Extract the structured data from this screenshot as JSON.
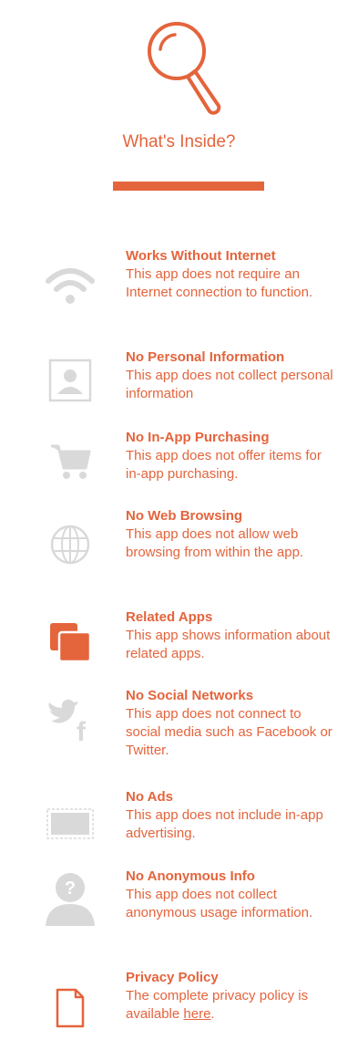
{
  "header": {
    "title": "What's Inside?",
    "icon": "magnifier-icon"
  },
  "colors": {
    "accent": "#e4643c",
    "icon_gray": "#d9d9d9"
  },
  "features": [
    {
      "icon": "wifi-icon",
      "title": "Works Without Internet",
      "desc": "This app does not require an Internet connection to function."
    },
    {
      "icon": "profile-photo-icon",
      "title": "No Personal Information",
      "desc": "This app does not collect personal information"
    },
    {
      "icon": "shopping-cart-icon",
      "title": "No In-App Purchasing",
      "desc": "This app does not offer items for in-app purchasing."
    },
    {
      "icon": "globe-icon",
      "title": "No Web Browsing",
      "desc": "This app does not allow web browsing from within the app."
    },
    {
      "icon": "stacked-squares-icon",
      "title": "Related Apps",
      "desc": "This app shows information about related apps."
    },
    {
      "icon": "twitter-facebook-icon",
      "title": "No Social Networks",
      "desc": "This app does not connect to social media such as Facebook or Twitter."
    },
    {
      "icon": "ad-banner-icon",
      "title": "No Ads",
      "desc": "This app does not include in-app advertising."
    },
    {
      "icon": "anonymous-user-icon",
      "title": "No Anonymous Info",
      "desc": "This app does not collect anonymous usage information."
    },
    {
      "icon": "document-icon",
      "title": "Privacy Policy",
      "desc": "The complete privacy policy is available ",
      "link": "here",
      "link_suffix": "."
    }
  ]
}
